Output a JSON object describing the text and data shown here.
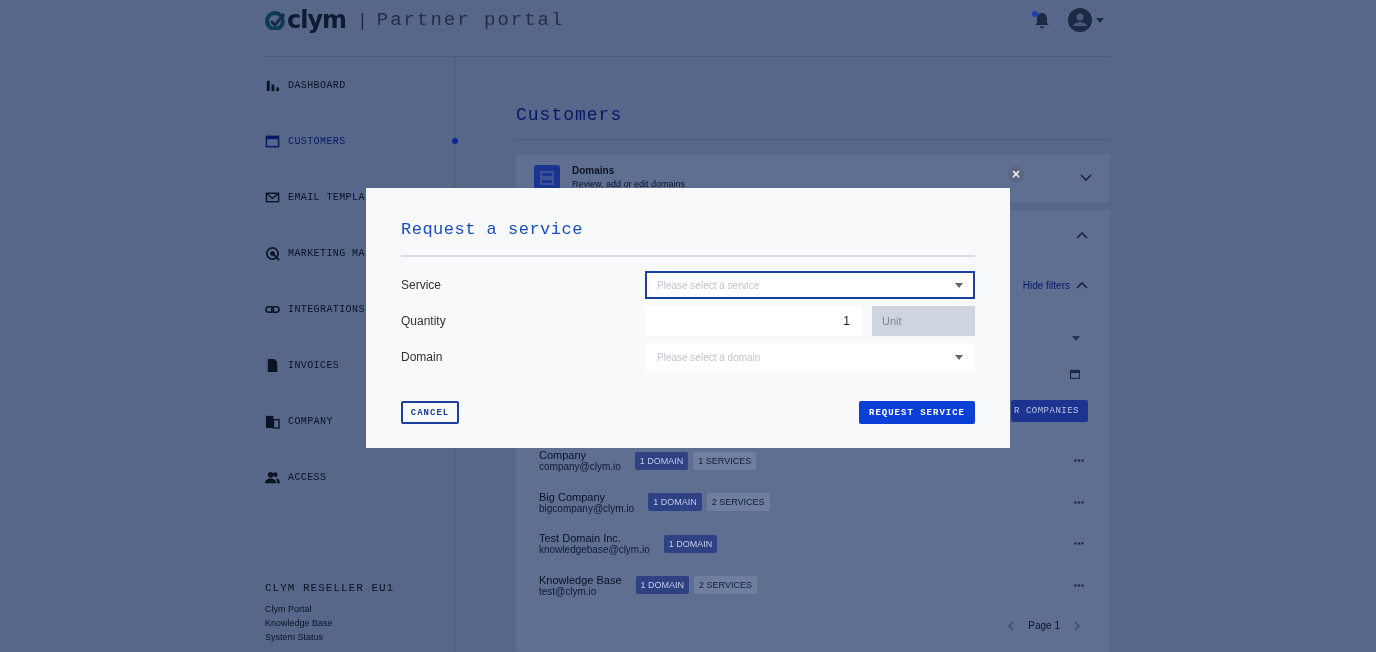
{
  "header": {
    "logo": "clym",
    "separator": "|",
    "title": "Partner portal",
    "notification_dot": true
  },
  "sidebar": {
    "items": [
      {
        "label": "DASHBOARD",
        "selected": false
      },
      {
        "label": "CUSTOMERS",
        "selected": true
      },
      {
        "label": "EMAIL TEMPLA",
        "selected": false
      },
      {
        "label": "MARKETING MA",
        "selected": false
      },
      {
        "label": "INTEGRATIONS",
        "selected": false
      },
      {
        "label": "INVOICES",
        "selected": false
      },
      {
        "label": "COMPANY",
        "selected": false
      },
      {
        "label": "ACCESS",
        "selected": false
      }
    ],
    "footer_title": "CLYM RESELLER EU1",
    "footer_links": [
      "Clym Portal",
      "Knowledge Base",
      "System Status"
    ]
  },
  "main": {
    "title": "Customers",
    "domains_card": {
      "title": "Domains",
      "subtitle": "Review, add or edit domains",
      "expanded": false
    },
    "filters_card": {
      "expanded": true,
      "toggle_label": "Hide filters",
      "button_label": "R COMPANIES"
    },
    "customers": [
      {
        "name": "Company",
        "email": "company@clym.io",
        "badges": [
          {
            "kind": "domain",
            "label": "1 DOMAIN"
          },
          {
            "kind": "services",
            "label": "1 SERVICES"
          }
        ]
      },
      {
        "name": "Big Company",
        "email": "bigcompany@clym.io",
        "badges": [
          {
            "kind": "domain",
            "label": "1 DOMAIN"
          },
          {
            "kind": "services",
            "label": "2 SERVICES"
          }
        ]
      },
      {
        "name": "Test Domain Inc.",
        "email": "knowledgebase@clym.io",
        "badges": [
          {
            "kind": "domain",
            "label": "1 DOMAIN"
          }
        ]
      },
      {
        "name": "Knowledge Base",
        "email": "test@clym.io",
        "badges": [
          {
            "kind": "domain",
            "label": "1 DOMAIN"
          },
          {
            "kind": "services",
            "label": "2 SERVICES"
          }
        ]
      }
    ],
    "pagination": {
      "label": "Page 1"
    }
  },
  "modal": {
    "title": "Request a service",
    "close_label": "×",
    "fields": [
      {
        "kind": "select",
        "label": "Service",
        "placeholder": "Please select a service",
        "focused": true
      },
      {
        "kind": "quantity",
        "label": "Quantity",
        "value": "1",
        "unit_placeholder": "Unit",
        "unit_disabled": true
      },
      {
        "kind": "select",
        "label": "Domain",
        "placeholder": "Please select a domain",
        "focused": false
      }
    ],
    "cancel_label": "CANCEL",
    "submit_label": "REQUEST SERVICE"
  }
}
